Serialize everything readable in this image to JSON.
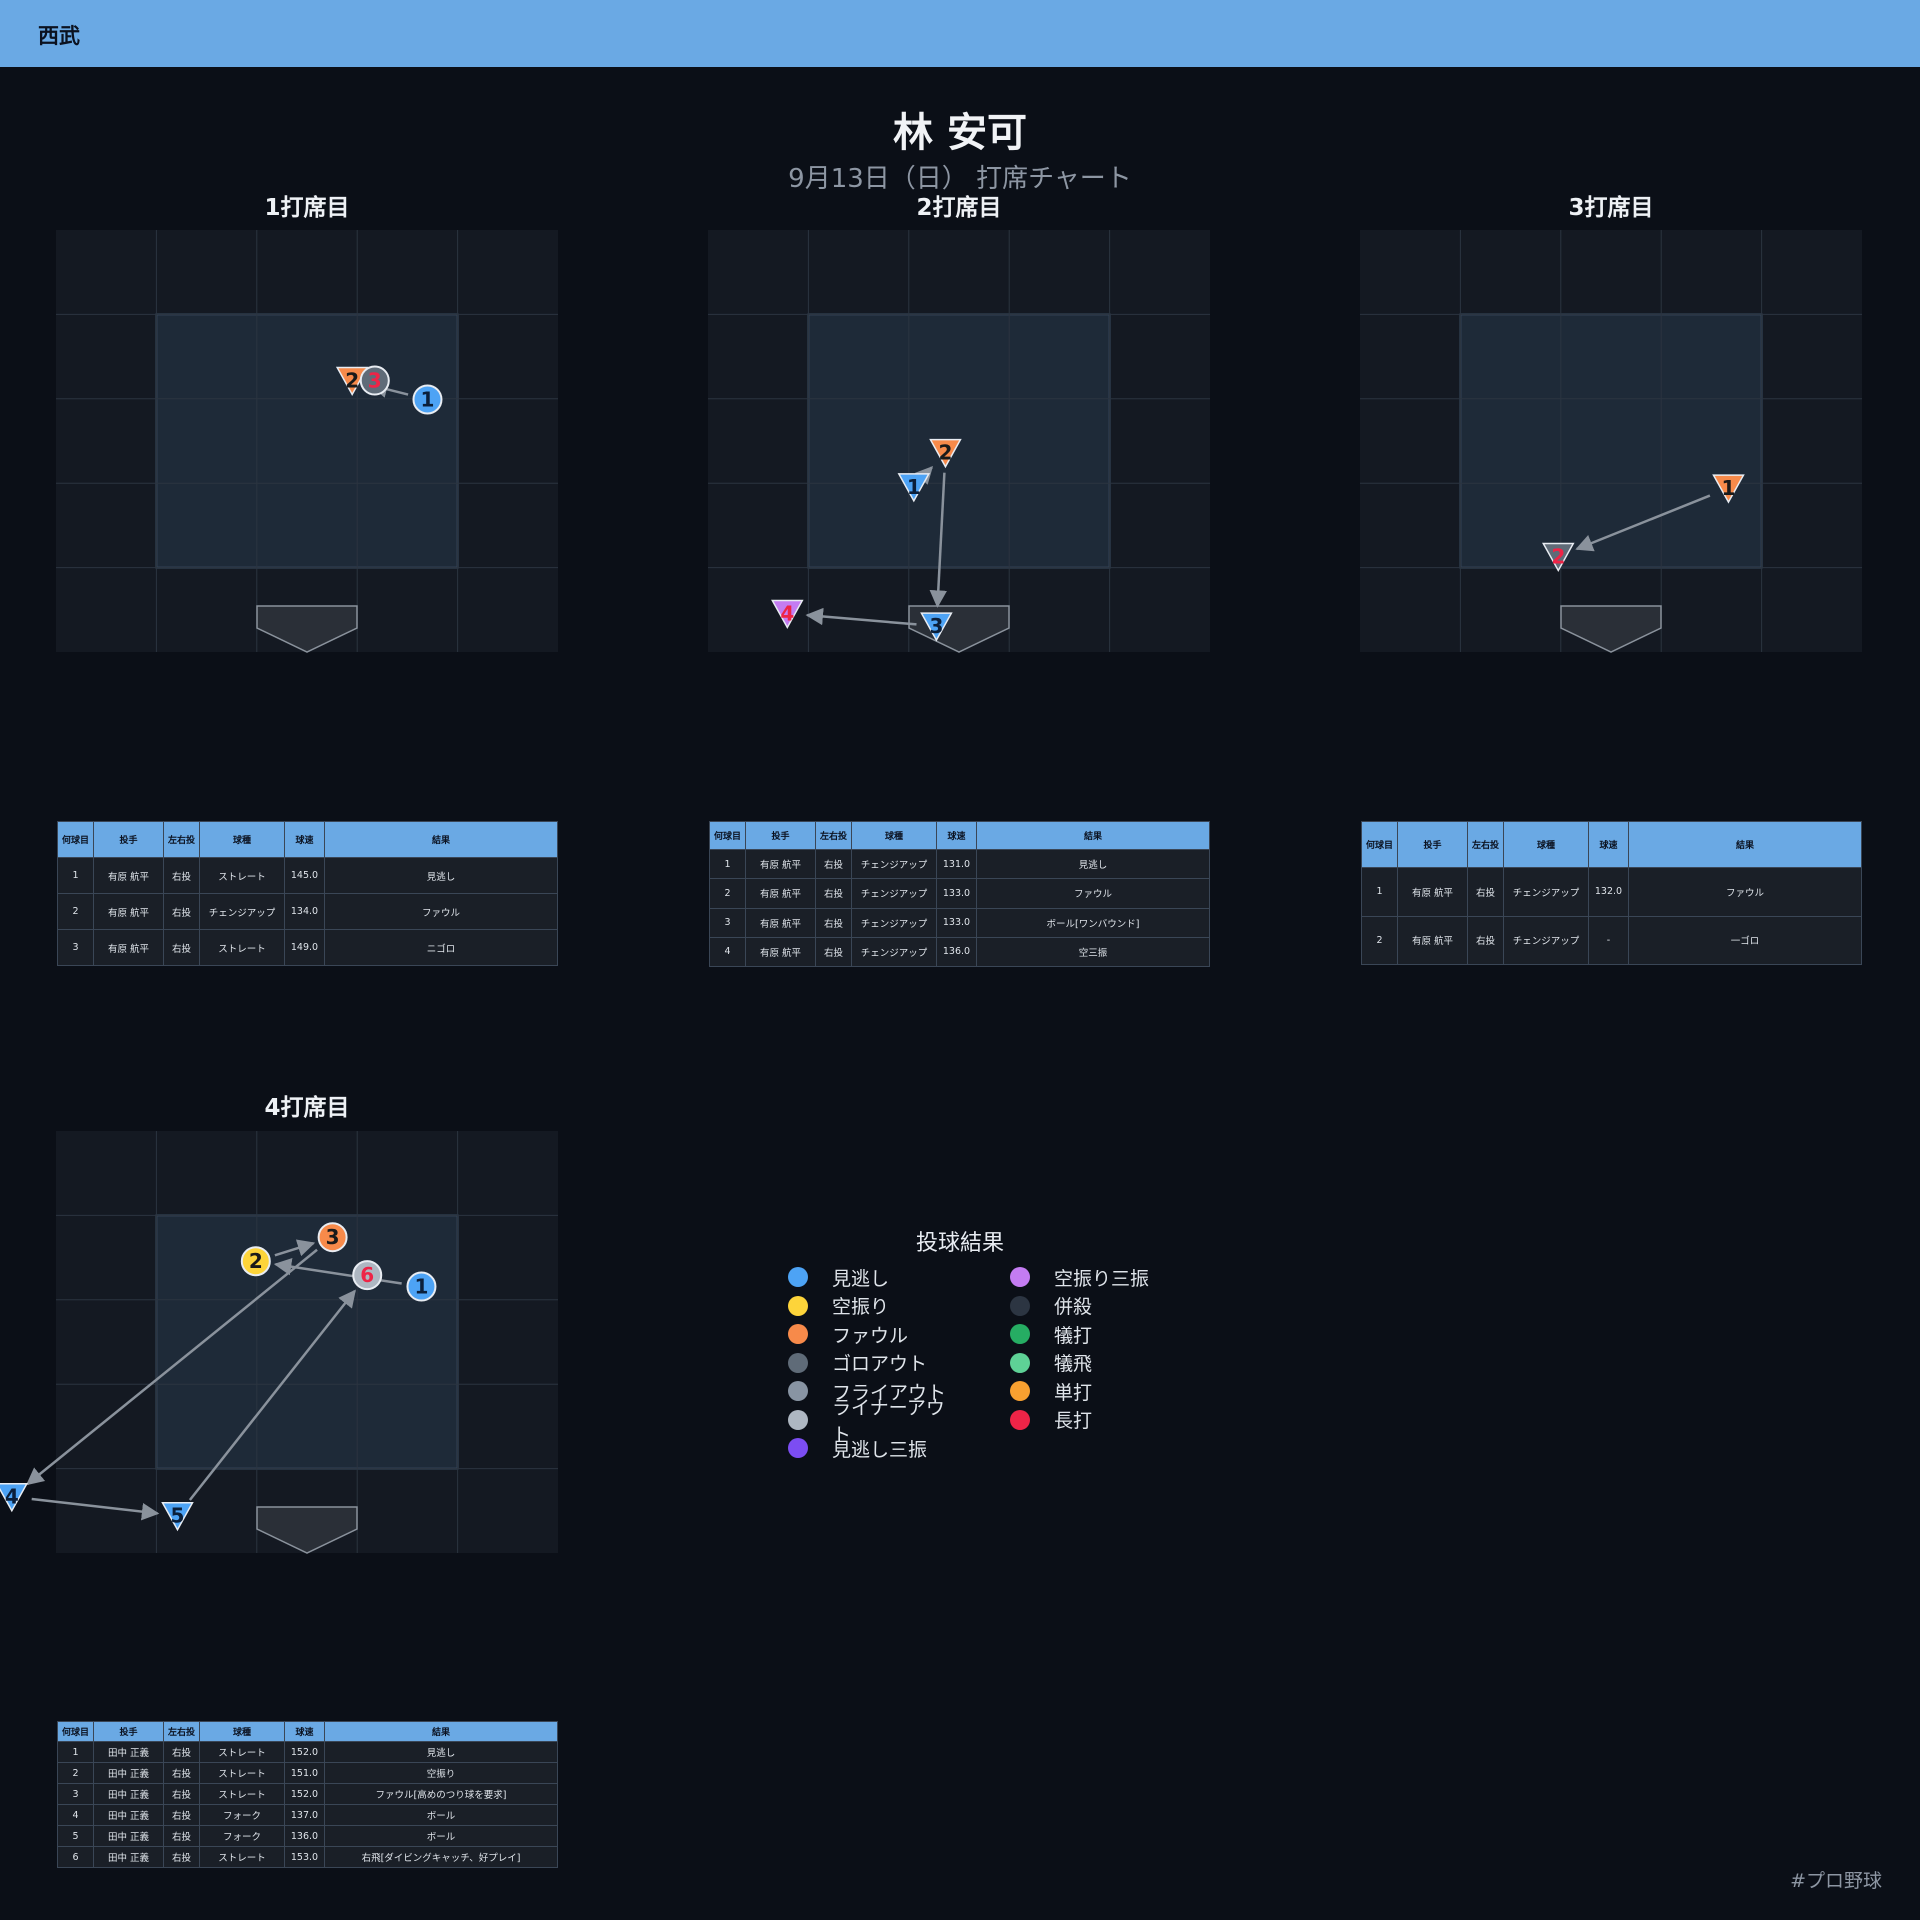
{
  "header": {
    "team": "西武"
  },
  "page": {
    "title": "林 安可",
    "subtitle": "9月13日（日） 打席チャート",
    "hashtag": "#プロ野球"
  },
  "colors": {
    "見逃し": "#4da3f5",
    "空振り": "#fdd43a",
    "ファウル": "#f78a4a",
    "ゴロアウト": "#5f6b78",
    "フライアウト": "#8894a3",
    "ライナーアウト": "#aeb7c2",
    "見逃し三振": "#7c4df2",
    "空振り三振": "#c47cf2",
    "併殺": "#2c3542",
    "犠打": "#26ad63",
    "犠飛": "#5ed196",
    "単打": "#f8a030",
    "長打": "#ee2447",
    "ボール": "#4da3f5"
  },
  "table_headers": [
    "何球目",
    "投手",
    "左右投",
    "球種",
    "球速",
    "結果"
  ],
  "legend": {
    "title": "投球結果",
    "items": [
      "見逃し",
      "空振り",
      "ファウル",
      "ゴロアウト",
      "フライアウト",
      "ライナーアウト",
      "見逃し三振",
      "空振り三振",
      "併殺",
      "犠打",
      "犠飛",
      "単打",
      "長打"
    ]
  },
  "chart_data": [
    {
      "type": "scatter",
      "title": "1打席目",
      "pitches": [
        {
          "n": 1,
          "x": 0.8,
          "y": 0.32,
          "result": "見逃し",
          "marker": "circle",
          "text_color": "#0b1f3a"
        },
        {
          "n": 2,
          "x": 0.3,
          "y": 0.47,
          "result": "ファウル",
          "marker": "triangle",
          "text_color": "#1a1a1a"
        },
        {
          "n": 3,
          "x": 0.45,
          "y": 0.47,
          "result": "ゴロアウト",
          "marker": "circle",
          "text_color": "#ee2447"
        }
      ],
      "table": [
        [
          "1",
          "有原 航平",
          "右投",
          "ストレート",
          "145.0",
          "見逃し"
        ],
        [
          "2",
          "有原 航平",
          "右投",
          "チェンジアップ",
          "134.0",
          "ファウル"
        ],
        [
          "3",
          "有原 航平",
          "右投",
          "ストレート",
          "149.0",
          "ニゴロ"
        ]
      ]
    },
    {
      "type": "scatter",
      "title": "2打席目",
      "pitches": [
        {
          "n": 1,
          "x": -0.3,
          "y": -0.37,
          "result": "見逃し",
          "marker": "triangle",
          "text_color": "#0b1f3a"
        },
        {
          "n": 2,
          "x": -0.09,
          "y": -0.1,
          "result": "ファウル",
          "marker": "triangle",
          "text_color": "#1a1a1a"
        },
        {
          "n": 3,
          "x": -0.15,
          "y": -1.47,
          "result": "ボール",
          "marker": "triangle",
          "text_color": "#0b1f3a"
        },
        {
          "n": 4,
          "x": -1.14,
          "y": -1.37,
          "result": "空振り三振",
          "marker": "triangle",
          "text_color": "#ee2447"
        }
      ],
      "table": [
        [
          "1",
          "有原 航平",
          "右投",
          "チェンジアップ",
          "131.0",
          "見逃し"
        ],
        [
          "2",
          "有原 航平",
          "右投",
          "チェンジアップ",
          "133.0",
          "ファウル"
        ],
        [
          "3",
          "有原 航平",
          "右投",
          "チェンジアップ",
          "133.0",
          "ボール[ワンバウンド]"
        ],
        [
          "4",
          "有原 航平",
          "右投",
          "チェンジアップ",
          "136.0",
          "空三振"
        ]
      ]
    },
    {
      "type": "scatter",
      "title": "3打席目",
      "pitches": [
        {
          "n": 1,
          "x": 0.78,
          "y": -0.38,
          "result": "ファウル",
          "marker": "triangle",
          "text_color": "#1a1a1a"
        },
        {
          "n": 2,
          "x": -0.35,
          "y": -0.92,
          "result": "ゴロアウト",
          "marker": "triangle",
          "text_color": "#ee2447"
        }
      ],
      "table": [
        [
          "1",
          "有原 航平",
          "右投",
          "チェンジアップ",
          "132.0",
          "ファウル"
        ],
        [
          "2",
          "有原 航平",
          "右投",
          "チェンジアップ",
          "-",
          "一ゴロ"
        ]
      ]
    },
    {
      "type": "scatter",
      "title": "4打席目",
      "pitches": [
        {
          "n": 1,
          "x": 0.76,
          "y": 0.43,
          "result": "見逃し",
          "marker": "circle",
          "text_color": "#0b1f3a"
        },
        {
          "n": 2,
          "x": -0.34,
          "y": 0.63,
          "result": "空振り",
          "marker": "circle",
          "text_color": "#1a1a1a"
        },
        {
          "n": 3,
          "x": 0.17,
          "y": 0.82,
          "result": "ファウル",
          "marker": "circle",
          "text_color": "#1a1a1a"
        },
        {
          "n": 4,
          "x": -1.96,
          "y": -1.23,
          "result": "ボール",
          "marker": "triangle",
          "text_color": "#0b1f3a"
        },
        {
          "n": 5,
          "x": -0.86,
          "y": -1.38,
          "result": "ボール",
          "marker": "triangle",
          "text_color": "#0b1f3a"
        },
        {
          "n": 6,
          "x": 0.4,
          "y": 0.52,
          "result": "ライナーアウト",
          "marker": "circle",
          "text_color": "#ee2447"
        }
      ],
      "table": [
        [
          "1",
          "田中 正義",
          "右投",
          "ストレート",
          "152.0",
          "見逃し"
        ],
        [
          "2",
          "田中 正義",
          "右投",
          "ストレート",
          "151.0",
          "空振り"
        ],
        [
          "3",
          "田中 正義",
          "右投",
          "ストレート",
          "152.0",
          "ファウル[高めのつり球を要求]"
        ],
        [
          "4",
          "田中 正義",
          "右投",
          "フォーク",
          "137.0",
          "ボール"
        ],
        [
          "5",
          "田中 正義",
          "右投",
          "フォーク",
          "136.0",
          "ボール"
        ],
        [
          "6",
          "田中 正義",
          "右投",
          "ストレート",
          "153.0",
          "右飛[ダイビングキャッチ、好プレイ]"
        ]
      ]
    }
  ]
}
